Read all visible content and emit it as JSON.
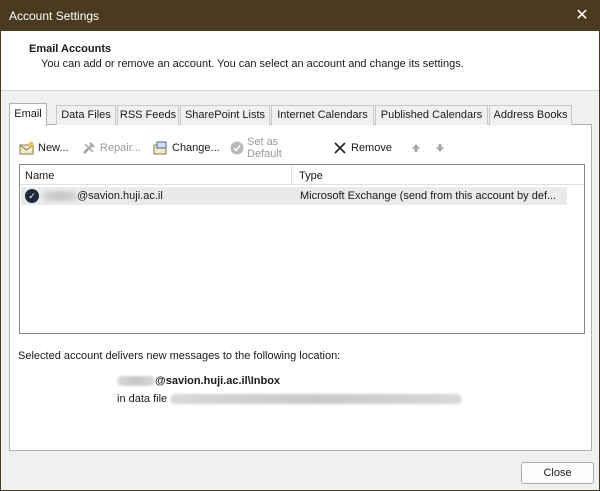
{
  "window": {
    "title": "Account Settings",
    "close_glyph": "✕"
  },
  "header": {
    "title": "Email Accounts",
    "subtitle": "You can add or remove an account. You can select an account and change its settings."
  },
  "tabs": [
    {
      "label": "Email",
      "active": true
    },
    {
      "label": "Data Files"
    },
    {
      "label": "RSS Feeds"
    },
    {
      "label": "SharePoint Lists"
    },
    {
      "label": "Internet Calendars"
    },
    {
      "label": "Published Calendars"
    },
    {
      "label": "Address Books"
    }
  ],
  "toolbar": {
    "new_label": "New...",
    "repair_label": "Repair...",
    "change_label": "Change...",
    "set_default_label": "Set as Default",
    "remove_label": "Remove",
    "up_glyph": "🡅",
    "down_glyph": "🡇"
  },
  "list": {
    "col_name": "Name",
    "col_type": "Type",
    "rows": [
      {
        "name_suffix": "@savion.huji.ac.il",
        "type": "Microsoft Exchange (send from this account by def..."
      }
    ]
  },
  "delivery": {
    "text": "Selected account delivers new messages to the following location:",
    "location_suffix": "@savion.huji.ac.il\\Inbox",
    "data_file_prefix": "in data file"
  },
  "footer": {
    "close_label": "Close"
  },
  "colors": {
    "titlebar": "#4a3a1f",
    "selected_row": "#eaeaea"
  }
}
